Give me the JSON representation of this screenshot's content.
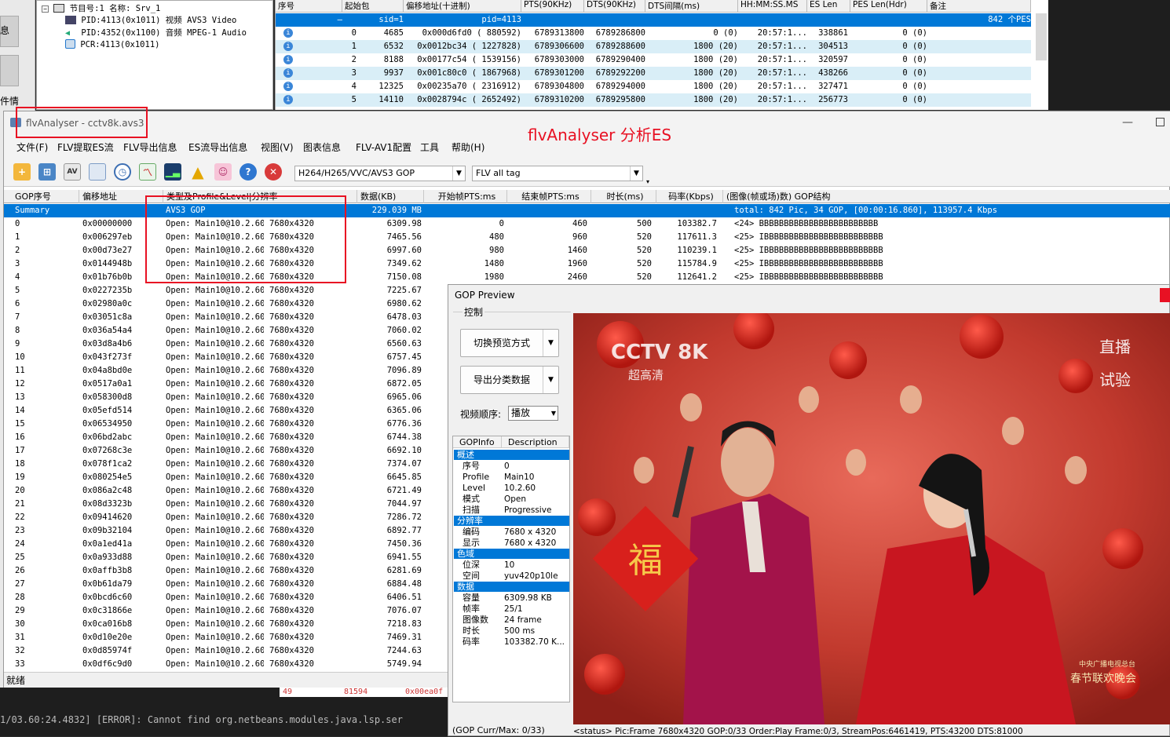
{
  "bg": {
    "left_labels": [
      "息",
      "件情"
    ],
    "tree": {
      "root": "节目号:1 名称: Srv_1",
      "items": [
        "PID:4113(0x1011) 视频 AVS3 Video",
        "PID:4352(0x1100) 音频 MPEG-1 Audio",
        "PCR:4113(0x1011)"
      ]
    },
    "table_headers": [
      "序号",
      "起始包",
      "偏移地址(十进制)",
      "PTS(90KHz)",
      "DTS(90KHz)",
      "DTS间隔(ms)",
      "HH:MM:SS.MS",
      "ES Len",
      "PES Len(Hdr)",
      "备注"
    ],
    "rows": [
      [
        "—",
        "sid=1",
        "pid=4113",
        "",
        "",
        "",
        "",
        "",
        "",
        "842 个PES"
      ],
      [
        "0",
        "4685",
        "0x000d6fd0 (  880592)",
        "6789313800",
        "6789286800",
        "0 (0)",
        "20:57:1...",
        "338861",
        "0 (0)",
        ""
      ],
      [
        "1",
        "6532",
        "0x0012bc34 ( 1227828)",
        "6789306600",
        "6789288600",
        "1800 (20)",
        "20:57:1...",
        "304513",
        "0 (0)",
        ""
      ],
      [
        "2",
        "8188",
        "0x00177c54 ( 1539156)",
        "6789303000",
        "6789290400",
        "1800 (20)",
        "20:57:1...",
        "320597",
        "0 (0)",
        ""
      ],
      [
        "3",
        "9937",
        "0x001c80c0 ( 1867968)",
        "6789301200",
        "6789292200",
        "1800 (20)",
        "20:57:1...",
        "438266",
        "0 (0)",
        ""
      ],
      [
        "4",
        "12325",
        "0x00235a70 ( 2316912)",
        "6789304800",
        "6789294000",
        "1800 (20)",
        "20:57:1...",
        "327471",
        "0 (0)",
        ""
      ],
      [
        "5",
        "14110",
        "0x0028794c ( 2652492)",
        "6789310200",
        "6789295800",
        "1800 (20)",
        "20:57:1...",
        "256773",
        "0 (0)",
        ""
      ]
    ],
    "behind_row": [
      "49",
      "81594",
      "0x00ea0f"
    ],
    "console_text": "1/03.60:24.4832] [ERROR]: Cannot find org.netbeans.modules.java.lsp.ser"
  },
  "window": {
    "title": "flvAnalyser - cctv8k.avs3",
    "menus": [
      "文件(F)",
      "FLV提取ES流",
      "FLV导出信息",
      "ES流导出信息",
      "视图(V)",
      "图表信息",
      "FLV-AV1配置",
      "工具",
      "帮助(H)"
    ],
    "combo1": "H264/H265/VVC/AVS3 GOP",
    "combo2": "FLV all tag",
    "status": "就绪"
  },
  "annotation": "flvAnalyser 分析ES",
  "grid": {
    "headers": [
      "GOP序号",
      "偏移地址",
      "类型及Profile&Level|分辨率",
      "数据(KB)",
      "开始帧PTS:ms",
      "结束帧PTS:ms",
      "时长(ms)",
      "码率(Kbps)",
      "(图像(帧或场)数) GOP结构"
    ],
    "summary": [
      "Summary",
      "",
      "AVS3 GOP",
      "229.039 MB",
      "",
      "",
      "",
      "",
      "total: 842 Pic, 34 GOP, [00:00:16.860], 113957.4 Kbps"
    ],
    "rows": [
      [
        "0",
        "0x00000000",
        "Open: Main10@10.2.60",
        "7680x4320",
        "6309.98",
        "0",
        "460",
        "500",
        "103382.7",
        "<24> BBBBBBBBBBBBBBBBBBBBBBBB"
      ],
      [
        "1",
        "0x006297eb",
        "Open: Main10@10.2.60",
        "7680x4320",
        "7465.56",
        "480",
        "960",
        "520",
        "117611.3",
        "<25> IBBBBBBBBBBBBBBBBBBBBBBBB"
      ],
      [
        "2",
        "0x00d73e27",
        "Open: Main10@10.2.60",
        "7680x4320",
        "6997.60",
        "980",
        "1460",
        "520",
        "110239.1",
        "<25> IBBBBBBBBBBBBBBBBBBBBBBBB"
      ],
      [
        "3",
        "0x0144948b",
        "Open: Main10@10.2.60",
        "7680x4320",
        "7349.62",
        "1480",
        "1960",
        "520",
        "115784.9",
        "<25> IBBBBBBBBBBBBBBBBBBBBBBBB"
      ],
      [
        "4",
        "0x01b76b0b",
        "Open: Main10@10.2.60",
        "7680x4320",
        "7150.08",
        "1980",
        "2460",
        "520",
        "112641.2",
        "<25> IBBBBBBBBBBBBBBBBBBBBBBBB"
      ],
      [
        "5",
        "0x0227235b",
        "Open: Main10@10.2.60",
        "7680x4320",
        "7225.67",
        "",
        "",
        "",
        "",
        ""
      ],
      [
        "6",
        "0x02980a0c",
        "Open: Main10@10.2.60",
        "7680x4320",
        "6980.62",
        "",
        "",
        "",
        "",
        ""
      ],
      [
        "7",
        "0x03051c8a",
        "Open: Main10@10.2.60",
        "7680x4320",
        "6478.03",
        "",
        "",
        "",
        "",
        ""
      ],
      [
        "8",
        "0x036a54a4",
        "Open: Main10@10.2.60",
        "7680x4320",
        "7060.02",
        "",
        "",
        "",
        "",
        ""
      ],
      [
        "9",
        "0x03d8a4b6",
        "Open: Main10@10.2.60",
        "7680x4320",
        "6560.63",
        "",
        "",
        "",
        "",
        ""
      ],
      [
        "10",
        "0x043f273f",
        "Open: Main10@10.2.60",
        "7680x4320",
        "6757.45",
        "",
        "",
        "",
        "",
        ""
      ],
      [
        "11",
        "0x04a8bd0e",
        "Open: Main10@10.2.60",
        "7680x4320",
        "7096.89",
        "",
        "",
        "",
        "",
        ""
      ],
      [
        "12",
        "0x0517a0a1",
        "Open: Main10@10.2.60",
        "7680x4320",
        "6872.05",
        "",
        "",
        "",
        "",
        ""
      ],
      [
        "13",
        "0x058300d8",
        "Open: Main10@10.2.60",
        "7680x4320",
        "6965.06",
        "",
        "",
        "",
        "",
        ""
      ],
      [
        "14",
        "0x05efd514",
        "Open: Main10@10.2.60",
        "7680x4320",
        "6365.06",
        "",
        "",
        "",
        "",
        ""
      ],
      [
        "15",
        "0x06534950",
        "Open: Main10@10.2.60",
        "7680x4320",
        "6776.36",
        "",
        "",
        "",
        "",
        ""
      ],
      [
        "16",
        "0x06bd2abc",
        "Open: Main10@10.2.60",
        "7680x4320",
        "6744.38",
        "",
        "",
        "",
        "",
        ""
      ],
      [
        "17",
        "0x07268c3e",
        "Open: Main10@10.2.60",
        "7680x4320",
        "6692.10",
        "",
        "",
        "",
        "",
        ""
      ],
      [
        "18",
        "0x078f1ca2",
        "Open: Main10@10.2.60",
        "7680x4320",
        "7374.07",
        "",
        "",
        "",
        "",
        ""
      ],
      [
        "19",
        "0x080254e5",
        "Open: Main10@10.2.60",
        "7680x4320",
        "6645.85",
        "",
        "",
        "",
        "",
        ""
      ],
      [
        "20",
        "0x086a2c48",
        "Open: Main10@10.2.60",
        "7680x4320",
        "6721.49",
        "",
        "",
        "",
        "",
        ""
      ],
      [
        "21",
        "0x08d3323b",
        "Open: Main10@10.2.60",
        "7680x4320",
        "7044.97",
        "",
        "",
        "",
        "",
        ""
      ],
      [
        "22",
        "0x09414620",
        "Open: Main10@10.2.60",
        "7680x4320",
        "7286.72",
        "",
        "",
        "",
        "",
        ""
      ],
      [
        "23",
        "0x09b32104",
        "Open: Main10@10.2.60",
        "7680x4320",
        "6892.77",
        "",
        "",
        "",
        "",
        ""
      ],
      [
        "24",
        "0x0a1ed41a",
        "Open: Main10@10.2.60",
        "7680x4320",
        "7450.36",
        "",
        "",
        "",
        "",
        ""
      ],
      [
        "25",
        "0x0a933d88",
        "Open: Main10@10.2.60",
        "7680x4320",
        "6941.55",
        "",
        "",
        "",
        "",
        ""
      ],
      [
        "26",
        "0x0affb3b8",
        "Open: Main10@10.2.60",
        "7680x4320",
        "6281.69",
        "",
        "",
        "",
        "",
        ""
      ],
      [
        "27",
        "0x0b61da79",
        "Open: Main10@10.2.60",
        "7680x4320",
        "6884.48",
        "",
        "",
        "",
        "",
        ""
      ],
      [
        "28",
        "0x0bcd6c60",
        "Open: Main10@10.2.60",
        "7680x4320",
        "6406.51",
        "",
        "",
        "",
        "",
        ""
      ],
      [
        "29",
        "0x0c31866e",
        "Open: Main10@10.2.60",
        "7680x4320",
        "7076.07",
        "",
        "",
        "",
        "",
        ""
      ],
      [
        "30",
        "0x0ca016b8",
        "Open: Main10@10.2.60",
        "7680x4320",
        "7218.83",
        "",
        "",
        "",
        "",
        ""
      ],
      [
        "31",
        "0x0d10e20e",
        "Open: Main10@10.2.60",
        "7680x4320",
        "7469.31",
        "",
        "",
        "",
        "",
        ""
      ],
      [
        "32",
        "0x0d85974f",
        "Open: Main10@10.2.60",
        "7680x4320",
        "7244.63",
        "",
        "",
        "",
        "",
        ""
      ],
      [
        "33",
        "0x0df6c9d0",
        "Open: Main10@10.2.60",
        "7680x4320",
        "5749.94",
        "",
        "",
        "",
        "",
        ""
      ]
    ]
  },
  "gop": {
    "title": "GOP Preview",
    "group": "控制",
    "btn1": "切换预览方式",
    "btn2": "导出分类数据",
    "order_label": "视频顺序:",
    "order_value": "播放",
    "info_headers": [
      "GOPInfo",
      "Description"
    ],
    "info": [
      {
        "section": "概述",
        "items": [
          [
            "序号",
            "0"
          ],
          [
            "Profile",
            "Main10"
          ],
          [
            "Level",
            "10.2.60"
          ],
          [
            "模式",
            "Open"
          ],
          [
            "扫描",
            "Progressive"
          ]
        ]
      },
      {
        "section": "分辨率",
        "items": [
          [
            "编码",
            "7680 x 4320"
          ],
          [
            "显示",
            "7680 x 4320"
          ]
        ]
      },
      {
        "section": "色域",
        "items": [
          [
            "位深",
            "10"
          ],
          [
            "空间",
            "yuv420p10le"
          ]
        ]
      },
      {
        "section": "数据",
        "items": [
          [
            "容量",
            "6309.98 KB"
          ],
          [
            "帧率",
            "25/1"
          ],
          [
            "图像数",
            "24 frame"
          ],
          [
            "时长",
            "500 ms"
          ],
          [
            "码率",
            "103382.70 K..."
          ]
        ]
      }
    ],
    "curmax": "(GOP Curr/Max: 0/33)",
    "status": "<status> Pic:Frame  7680x4320  GOP:0/33  Order:Play  Frame:0/3,  StreamPos:6461419,  PTS:43200  DTS:81000",
    "video": {
      "logo": "CCTV 8K",
      "logo_sub": "超高清",
      "live1": "直播",
      "live2": "试验",
      "fu": "福",
      "gala": "春节联欢晚会",
      "gala_small": "中央广播电视总台"
    }
  },
  "colors": {
    "accent": "#0078d7",
    "alt_row": "#d9eef7",
    "annotation": "#e81123"
  }
}
